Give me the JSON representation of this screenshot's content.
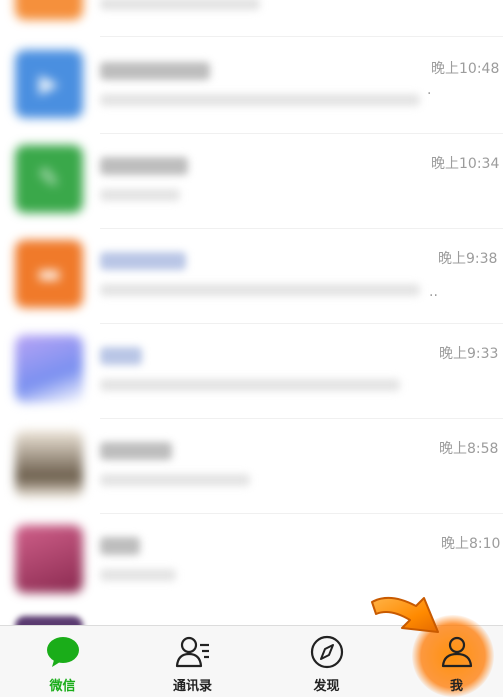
{
  "chats": [
    {
      "time": "",
      "avatar_color": "#f5903c",
      "avatar_glyph": ""
    },
    {
      "time": "晚上10:48",
      "avatar_color": "#4a8fe0",
      "avatar_glyph": "▶"
    },
    {
      "time": "晚上10:34",
      "avatar_color": "#3aa84a",
      "avatar_glyph": "✎"
    },
    {
      "time": "晚上9:38",
      "avatar_color": "#f07a2a",
      "avatar_glyph": "▬"
    },
    {
      "time": "晚上9:33",
      "avatar_color": "#9a7af0",
      "avatar_glyph": ""
    },
    {
      "time": "晚上8:58",
      "avatar_color": "#8a7a62",
      "avatar_glyph": ""
    },
    {
      "time": "晚上8:10",
      "avatar_color": "#b0406a",
      "avatar_glyph": ""
    }
  ],
  "tabbar": {
    "tabs": [
      {
        "label": "微信",
        "icon": "chat-bubble-icon",
        "active": true
      },
      {
        "label": "通讯录",
        "icon": "contacts-icon",
        "active": false
      },
      {
        "label": "发现",
        "icon": "compass-icon",
        "active": false
      },
      {
        "label": "我",
        "icon": "person-icon",
        "active": false
      }
    ]
  },
  "colors": {
    "accent": "#1aad19",
    "highlight": "#ff8c00"
  }
}
